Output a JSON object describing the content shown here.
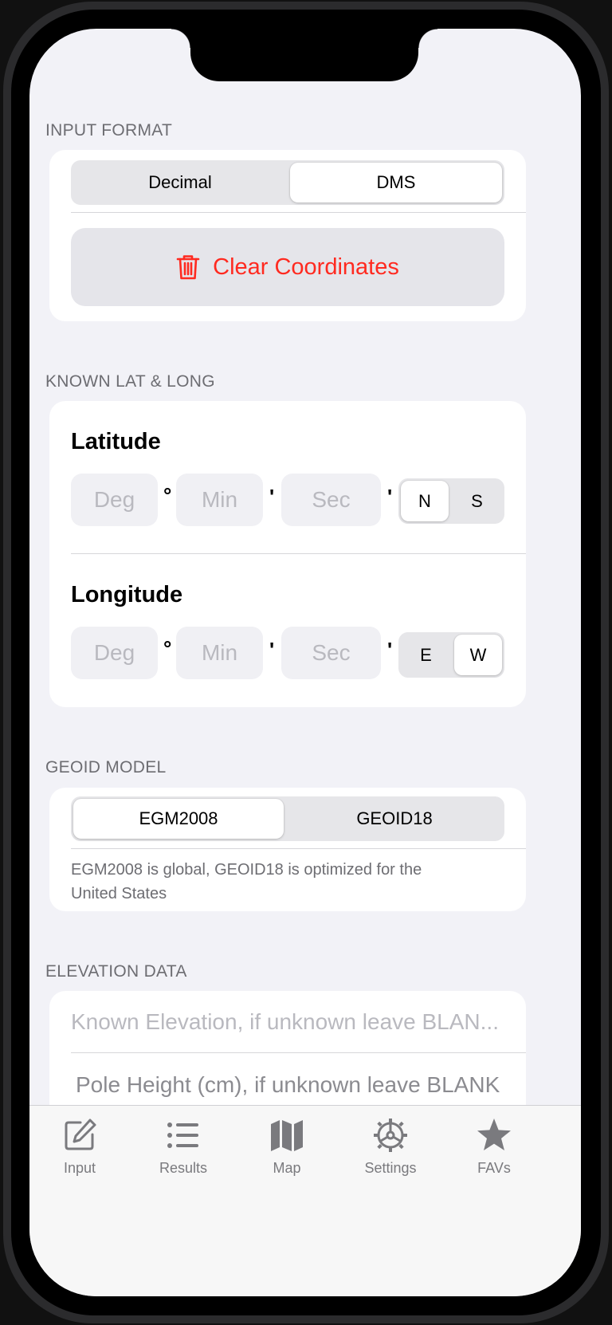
{
  "input_format": {
    "header": "INPUT FORMAT",
    "options": [
      "Decimal",
      "DMS"
    ],
    "selected": "DMS",
    "clear_button": "Clear Coordinates"
  },
  "known_lat_long": {
    "header": "KNOWN LAT & LONG",
    "latitude": {
      "title": "Latitude",
      "deg_placeholder": "Deg",
      "min_placeholder": "Min",
      "sec_placeholder": "Sec",
      "deg_mark": "°",
      "min_mark": "'",
      "sec_mark": "'",
      "hemisphere_options": [
        "N",
        "S"
      ],
      "hemisphere_selected": "N"
    },
    "longitude": {
      "title": "Longitude",
      "deg_placeholder": "Deg",
      "min_placeholder": "Min",
      "sec_placeholder": "Sec",
      "deg_mark": "°",
      "min_mark": "'",
      "sec_mark": "'",
      "hemisphere_options": [
        "E",
        "W"
      ],
      "hemisphere_selected": "W"
    }
  },
  "geoid_model": {
    "header": "GEOID MODEL",
    "options": [
      "EGM2008",
      "GEOID18"
    ],
    "selected": "EGM2008",
    "note": "EGM2008 is global, GEOID18 is optimized for the United States"
  },
  "elevation_data": {
    "header": "ELEVATION DATA",
    "known_elevation_placeholder": "Known Elevation, if unknown leave BLAN...",
    "pole_height_placeholder": "Pole Height (cm), if unknown leave BLANK"
  },
  "tabbar": {
    "items": [
      {
        "label": "Input",
        "icon": "compose-icon"
      },
      {
        "label": "Results",
        "icon": "list-icon"
      },
      {
        "label": "Map",
        "icon": "map-icon"
      },
      {
        "label": "Settings",
        "icon": "gear-icon"
      },
      {
        "label": "FAVs",
        "icon": "star-icon"
      }
    ]
  },
  "colors": {
    "destructive": "#ff2a20",
    "background": "#f2f2f7",
    "tab_inactive": "#7a7a7e"
  }
}
